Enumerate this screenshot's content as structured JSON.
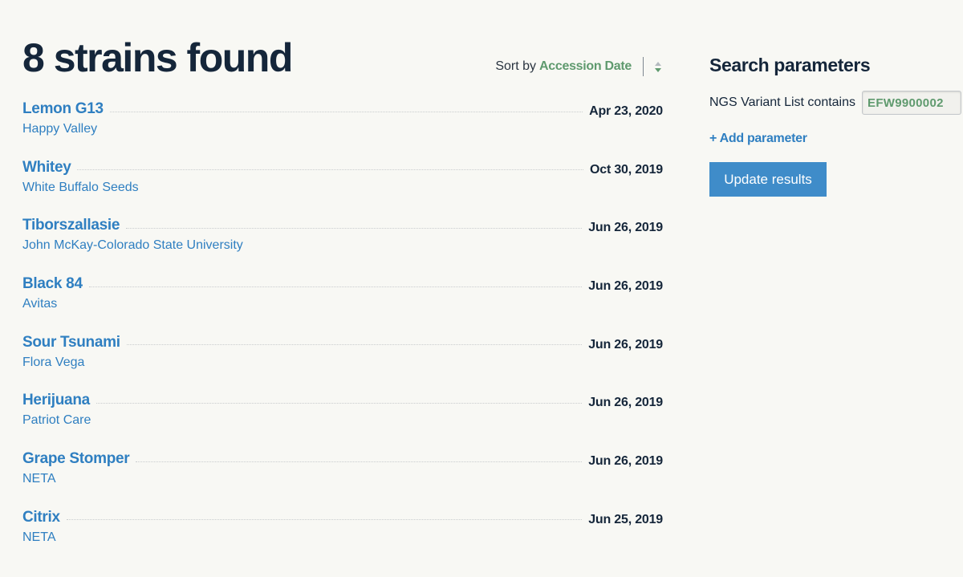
{
  "results": {
    "title": "8 strains found",
    "sort": {
      "prefix": "Sort by",
      "value": "Accession Date",
      "icon": "sort-arrows-icon"
    },
    "strains": [
      {
        "name": "Lemon G13",
        "breeder": "Happy Valley",
        "date": "Apr 23, 2020"
      },
      {
        "name": "Whitey",
        "breeder": "White Buffalo Seeds",
        "date": "Oct 30, 2019"
      },
      {
        "name": "Tiborszallasie",
        "breeder": "John McKay-Colorado State University",
        "date": "Jun 26, 2019"
      },
      {
        "name": "Black 84",
        "breeder": "Avitas",
        "date": "Jun 26, 2019"
      },
      {
        "name": "Sour Tsunami",
        "breeder": "Flora Vega",
        "date": "Jun 26, 2019"
      },
      {
        "name": "Herijuana",
        "breeder": "Patriot Care",
        "date": "Jun 26, 2019"
      },
      {
        "name": "Grape Stomper",
        "breeder": "NETA",
        "date": "Jun 26, 2019"
      },
      {
        "name": "Citrix",
        "breeder": "NETA",
        "date": "Jun 25, 2019"
      }
    ]
  },
  "sidebar": {
    "title": "Search parameters",
    "parameter": {
      "label": "NGS Variant List contains",
      "value": "EFW9900002"
    },
    "add_parameter_label": "+ Add parameter",
    "update_button_label": "Update results"
  },
  "colors": {
    "background": "#f8f8f4",
    "link": "#2f7fc1",
    "accent_green": "#5f9a6e",
    "heading": "#15263a",
    "button": "#3f8cc9"
  }
}
